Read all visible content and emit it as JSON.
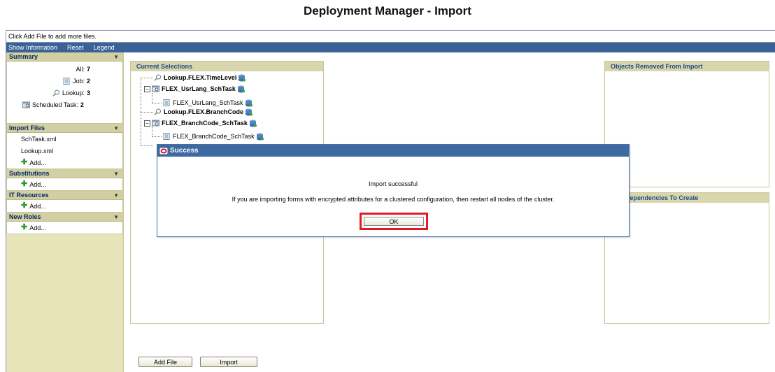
{
  "page": {
    "title": "Deployment Manager - Import"
  },
  "hint": "Click Add File to add more files.",
  "menu": [
    "Show Information",
    "Reset",
    "Legend"
  ],
  "sidebar": {
    "summary": {
      "title": "Summary",
      "rows": [
        {
          "label": "All:",
          "value": "7"
        },
        {
          "label": "Job:",
          "value": "2"
        },
        {
          "label": "Lookup:",
          "value": "3"
        },
        {
          "label": "Scheduled Task:",
          "value": "2"
        }
      ]
    },
    "import_files": {
      "title": "Import Files",
      "files": [
        "SchTask.xml",
        "Lookup.xml"
      ],
      "add_label": "Add..."
    },
    "substitutions": {
      "title": "Substitutions",
      "add_label": "Add..."
    },
    "it_resources": {
      "title": "IT Resources",
      "add_label": "Add..."
    },
    "new_roles": {
      "title": "New Roles",
      "add_label": "Add..."
    }
  },
  "selections": {
    "title": "Current Selections",
    "items": [
      "Lookup.FLEX.TimeLevel",
      "FLEX_UsrLang_SchTask",
      "FLEX_UsrLang_SchTask",
      "Lookup.FLEX.BranchCode",
      "FLEX_BranchCode_SchTask",
      "FLEX_BranchCode_SchTask"
    ]
  },
  "right": {
    "removed_title": "Objects Removed From Import",
    "dependencies_title": "sing Dependencies To Create"
  },
  "buttons": {
    "add_file": "Add File",
    "import": "Import"
  },
  "dialog": {
    "title": "Success",
    "message1": "Import successful",
    "message2": "If you are importing forms with encrypted attributes for a clustered configuration, then restart all nodes of the cluster.",
    "ok_label": "OK"
  },
  "colors": {
    "menu_bar": "#3a6298",
    "sidebar": "#e6e4b8",
    "dialog_title": "#3c6aa1",
    "highlight": "#e01b24"
  }
}
